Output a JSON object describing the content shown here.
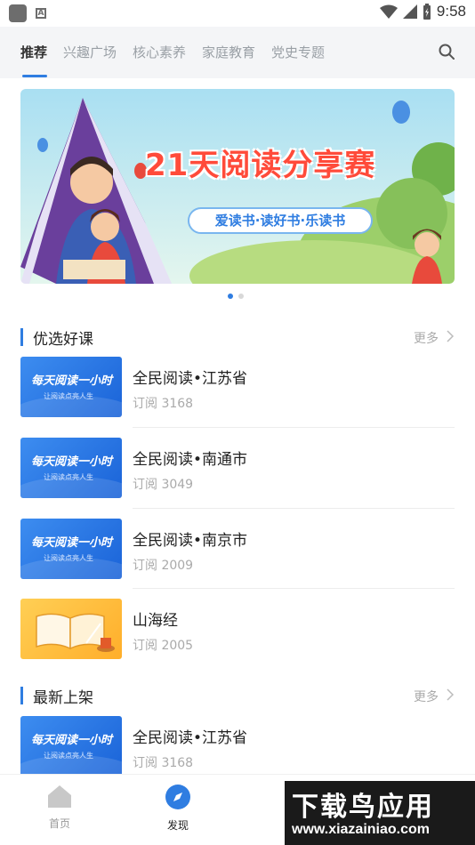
{
  "status_bar": {
    "time": "9:58"
  },
  "tabs": [
    {
      "label": "推荐",
      "active": true
    },
    {
      "label": "兴趣广场",
      "active": false
    },
    {
      "label": "核心素养",
      "active": false
    },
    {
      "label": "家庭教育",
      "active": false
    },
    {
      "label": "党史专题",
      "active": false
    }
  ],
  "banner": {
    "title": "21天阅读分享赛",
    "slogan": "爱读书·读好书·乐读书"
  },
  "sections": {
    "featured": {
      "title": "优选好课",
      "more": "更多"
    },
    "latest": {
      "title": "最新上架",
      "more": "更多"
    }
  },
  "thumb": {
    "title": "每天阅读一小时",
    "subtitle": "让阅读点亮人生"
  },
  "featured_courses": [
    {
      "title": "全民阅读•江苏省",
      "sub": "订阅 3168"
    },
    {
      "title": "全民阅读•南通市",
      "sub": "订阅 3049"
    },
    {
      "title": "全民阅读•南京市",
      "sub": "订阅 2009"
    },
    {
      "title": "山海经",
      "sub": "订阅 2005"
    }
  ],
  "latest_courses": [
    {
      "title": "全民阅读•江苏省",
      "sub": "订阅 3168"
    }
  ],
  "bottom_nav": [
    {
      "label": "首页",
      "active": false
    },
    {
      "label": "发现",
      "active": true
    }
  ],
  "watermark": {
    "main": "下载鸟应用",
    "url": "www.xiazainiao.com"
  },
  "colors": {
    "accent": "#2f7de1",
    "muted": "#aaaaaa",
    "tab_bg": "#f4f5f7"
  }
}
